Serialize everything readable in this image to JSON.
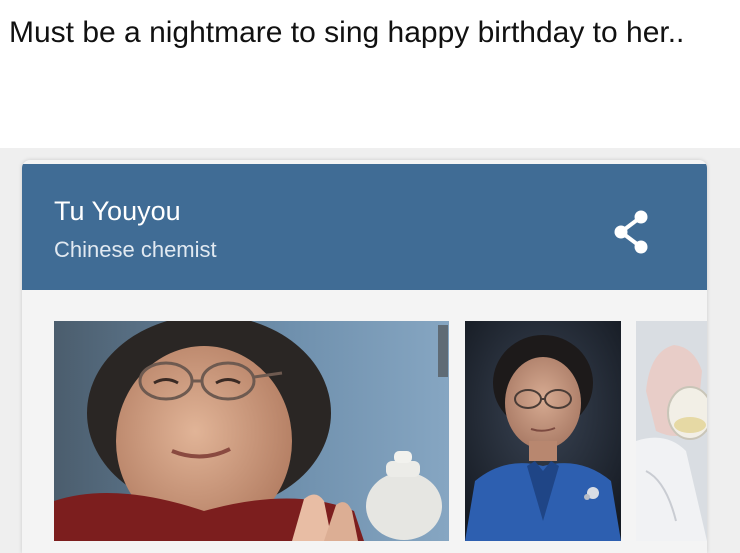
{
  "caption": "Must be a nightmare to sing happy birthday to her..",
  "panel": {
    "title": "Tu Youyou",
    "subtitle": "Chinese chemist",
    "share_icon": "share-icon"
  },
  "images": [
    {
      "name": "portrait-smiling"
    },
    {
      "name": "portrait-blue-jacket"
    },
    {
      "name": "lab-photo-partial"
    }
  ],
  "colors": {
    "header_bg": "#406c95",
    "header_text": "#ffffff"
  }
}
